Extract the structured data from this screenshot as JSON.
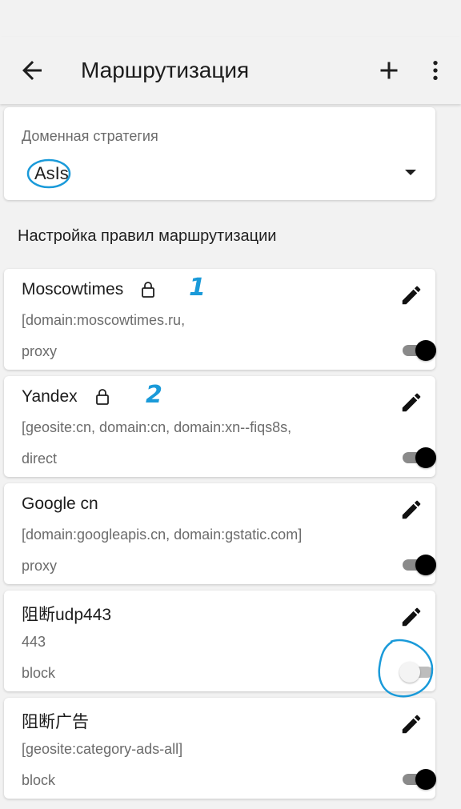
{
  "appbar": {
    "title": "Маршрутизация"
  },
  "domain_strategy": {
    "label": "Доменная стратегия",
    "value": "AsIs"
  },
  "section_title": "Настройка правил маршрутизации",
  "rules": [
    {
      "name": "Moscowtimes",
      "locked": true,
      "detail": "[domain:moscowtimes.ru,",
      "outbound": "proxy",
      "enabled": true
    },
    {
      "name": "Yandex",
      "locked": true,
      "detail": "[geosite:cn, domain:cn, domain:xn--fiqs8s,",
      "outbound": "direct",
      "enabled": true
    },
    {
      "name": "Google cn",
      "locked": false,
      "detail": "[domain:googleapis.cn, domain:gstatic.com]",
      "outbound": "proxy",
      "enabled": true
    },
    {
      "name": "阻断udp443",
      "locked": false,
      "detail": "443",
      "outbound": "block",
      "enabled": false
    },
    {
      "name": "阻断广告",
      "locked": false,
      "detail": "[geosite:category-ads-all]",
      "outbound": "block",
      "enabled": true
    }
  ],
  "annotations": [
    "1",
    "2"
  ],
  "colors": {
    "annotation": "#1a9ad9",
    "background": "#f2f2f2",
    "card": "#ffffff"
  }
}
